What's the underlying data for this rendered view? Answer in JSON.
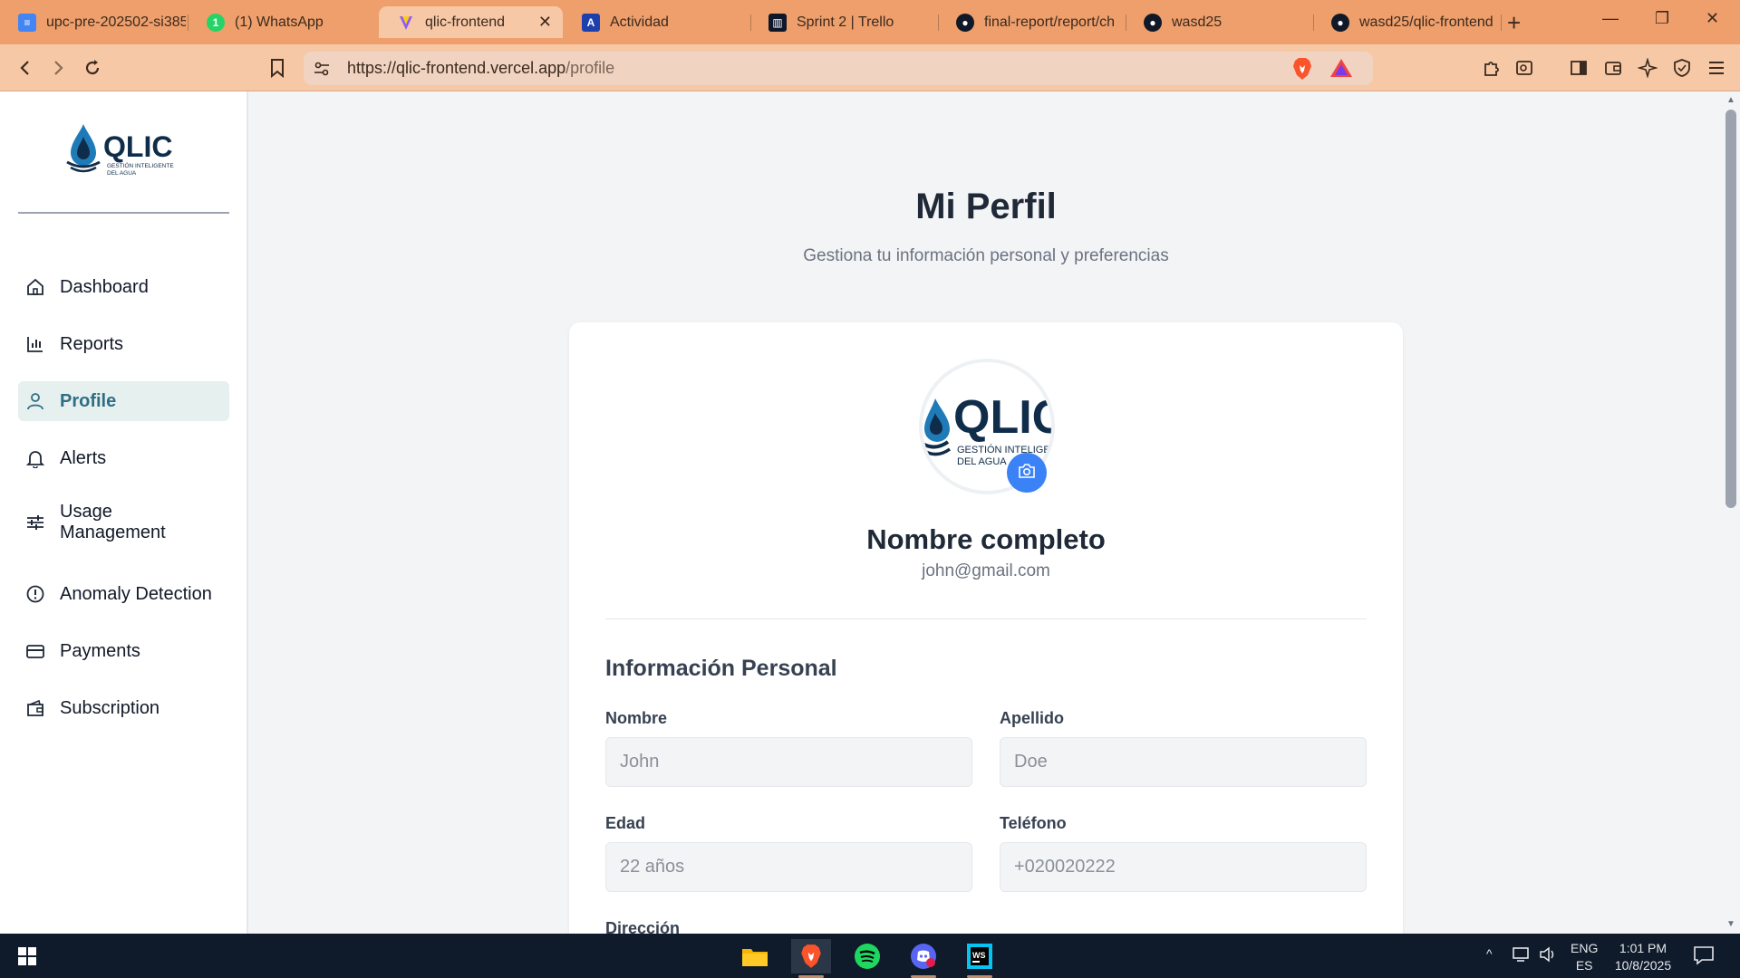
{
  "browser": {
    "tabs": [
      {
        "label": "upc-pre-202502-si385",
        "icon": "docs-icon",
        "color": "#4285f4"
      },
      {
        "label": "(1) WhatsApp",
        "icon": "whatsapp-icon",
        "color": "#25d366"
      },
      {
        "label": "qlic-frontend",
        "icon": "vercel-icon",
        "color": "#8b5cf6",
        "active": true
      },
      {
        "label": "Actividad",
        "icon": "activity-icon",
        "color": "#1e40af"
      },
      {
        "label": "Sprint 2 | Trello",
        "icon": "trello-icon",
        "color": "#0f172a"
      },
      {
        "label": "final-report/report/ch",
        "icon": "github-icon",
        "color": "#111827"
      },
      {
        "label": "wasd25",
        "icon": "github-icon",
        "color": "#111827"
      },
      {
        "label": "wasd25/qlic-frontend",
        "icon": "github-icon",
        "color": "#111827"
      }
    ],
    "new_tab_label": "+",
    "url_host": "https://qlic-frontend.vercel.app",
    "url_path": "/profile"
  },
  "sidebar": {
    "logo_text": "QLIC",
    "logo_tagline_1": "GESTIÓN INTELIGENTE",
    "logo_tagline_2": "DEL AGUA",
    "items": [
      {
        "label": "Dashboard",
        "icon": "home-icon"
      },
      {
        "label": "Reports",
        "icon": "bar-chart-icon"
      },
      {
        "label": "Profile",
        "icon": "user-icon",
        "active": true
      },
      {
        "label": "Alerts",
        "icon": "bell-icon"
      },
      {
        "label": "Usage Management",
        "icon": "sliders-icon"
      },
      {
        "label": "Anomaly Detection",
        "icon": "alert-circle-icon"
      },
      {
        "label": "Payments",
        "icon": "credit-card-icon"
      },
      {
        "label": "Subscription",
        "icon": "wallet-icon"
      }
    ]
  },
  "main": {
    "title": "Mi Perfil",
    "subtitle": "Gestiona tu información personal y preferencias",
    "profile": {
      "avatar_text": "QLIC",
      "avatar_tagline_1": "GESTIÓN INTELIGENTE",
      "avatar_tagline_2": "DEL AGUA",
      "full_name": "Nombre completo",
      "email": "john@gmail.com"
    },
    "section_title": "Información Personal",
    "fields": {
      "first_name": {
        "label": "Nombre",
        "placeholder": "John"
      },
      "last_name": {
        "label": "Apellido",
        "placeholder": "Doe"
      },
      "age": {
        "label": "Edad",
        "placeholder": "22 años"
      },
      "phone": {
        "label": "Teléfono",
        "placeholder": "+020020222"
      },
      "address": {
        "label": "Dirección"
      }
    }
  },
  "taskbar": {
    "apps": [
      "file-explorer-icon",
      "brave-icon",
      "spotify-icon",
      "discord-icon",
      "webstorm-icon"
    ],
    "lang_1": "ENG",
    "lang_2": "ES",
    "time": "1:01 PM",
    "date": "10/8/2025"
  },
  "colors": {
    "tabstrip": "#ef9f6c",
    "toolbar": "#f6c8a6",
    "accent": "#2f6f85",
    "camera_button": "#3b82f6"
  }
}
